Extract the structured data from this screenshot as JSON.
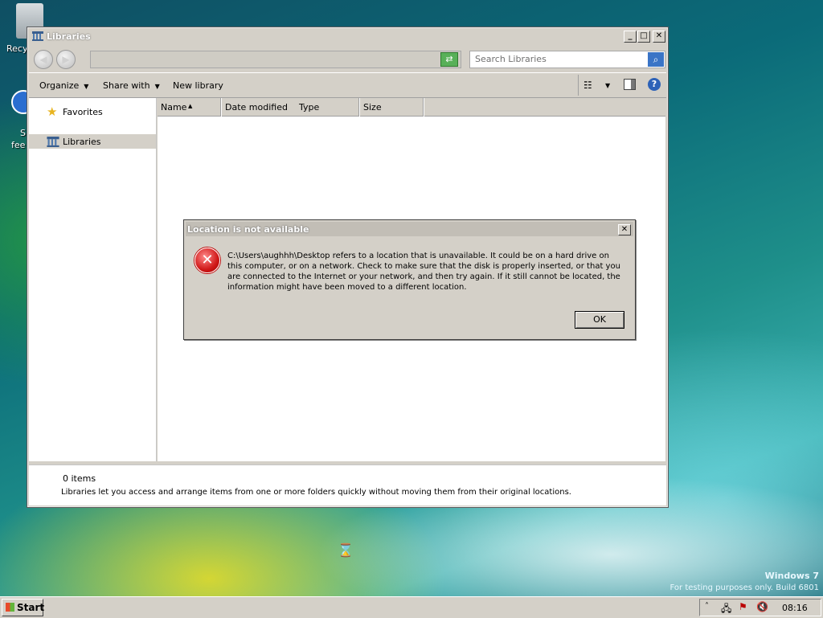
{
  "desktop": {
    "recycle_label": "Recy",
    "icon2_label_a": "S",
    "icon2_label_b": "fee",
    "watermark_title": "Windows 7",
    "watermark_build": "For testing purposes only. Build 6801"
  },
  "window": {
    "title": "Libraries",
    "minimize": "_",
    "maximize": "□",
    "close": "✕",
    "search_placeholder": "Search Libraries",
    "toolbar": {
      "organize": "Organize",
      "share_with": "Share with",
      "new_library": "New library"
    },
    "nav_items": [
      "Favorites",
      "Libraries"
    ],
    "columns": [
      "Name",
      "Date modified",
      "Type",
      "Size"
    ],
    "status_count": "0 items",
    "status_desc": "Libraries let you access and arrange items from one or more folders quickly without moving them from their original locations."
  },
  "dialog": {
    "title": "Location is not available",
    "message": "C:\\Users\\aughhh\\Desktop refers to a location that is unavailable. It could be on a hard drive on this computer, or on a network. Check to make sure that the disk is properly inserted, or that you are connected to the Internet or your network, and then try again. If it still cannot be located, the information might have been moved to a different location.",
    "ok": "OK",
    "close": "✕"
  },
  "taskbar": {
    "start": "Start",
    "clock": "08:16"
  }
}
